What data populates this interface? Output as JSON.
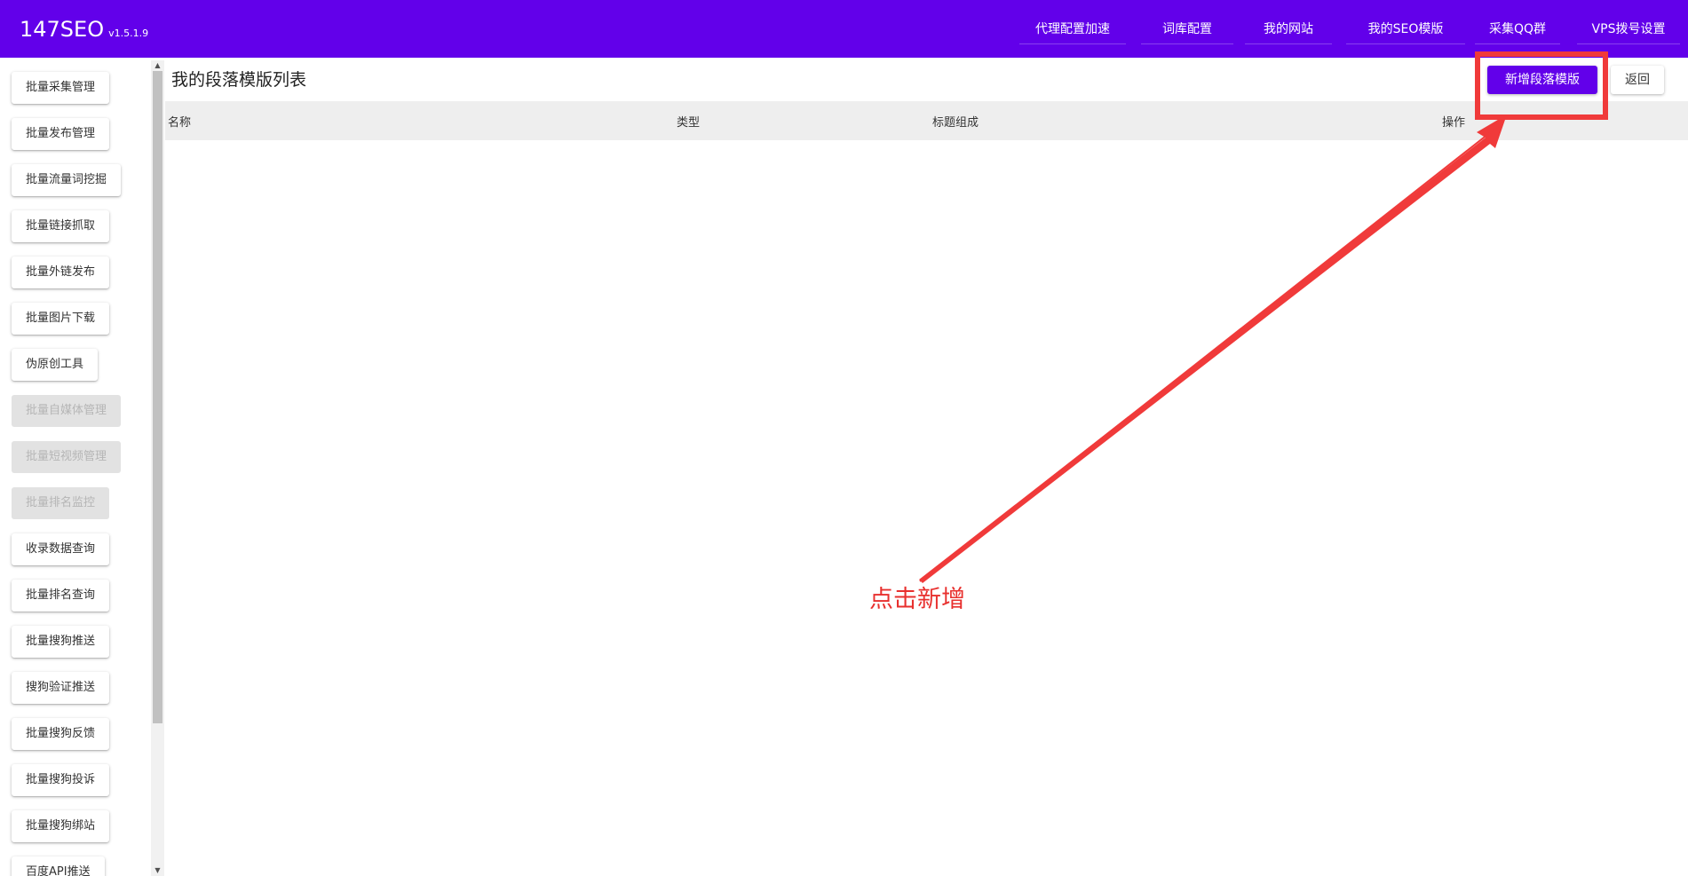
{
  "header": {
    "brand": "147SEO",
    "version": "v1.5.1.9",
    "nav": [
      {
        "label": "代理配置加速"
      },
      {
        "label": "词库配置"
      },
      {
        "label": "我的网站"
      },
      {
        "label": "我的SEO模版"
      },
      {
        "label": "采集QQ群"
      },
      {
        "label": "VPS拨号设置"
      }
    ]
  },
  "sidebar": {
    "items": [
      {
        "label": "批量采集管理",
        "enabled": true
      },
      {
        "label": "批量发布管理",
        "enabled": true
      },
      {
        "label": "批量流量词挖掘",
        "enabled": true
      },
      {
        "label": "批量链接抓取",
        "enabled": true
      },
      {
        "label": "批量外链发布",
        "enabled": true
      },
      {
        "label": "批量图片下载",
        "enabled": true
      },
      {
        "label": "伪原创工具",
        "enabled": true
      },
      {
        "label": "批量自媒体管理",
        "enabled": false
      },
      {
        "label": "批量短视频管理",
        "enabled": false
      },
      {
        "label": "批量排名监控",
        "enabled": false
      },
      {
        "label": "收录数据查询",
        "enabled": true
      },
      {
        "label": "批量排名查询",
        "enabled": true
      },
      {
        "label": "批量搜狗推送",
        "enabled": true
      },
      {
        "label": "搜狗验证推送",
        "enabled": true
      },
      {
        "label": "批量搜狗反馈",
        "enabled": true
      },
      {
        "label": "批量搜狗投诉",
        "enabled": true
      },
      {
        "label": "批量搜狗绑站",
        "enabled": true
      },
      {
        "label": "百度API推送",
        "enabled": true
      }
    ]
  },
  "main": {
    "title": "我的段落模版列表",
    "add_button": "新增段落模版",
    "back_button": "返回",
    "table": {
      "columns": [
        "名称",
        "类型",
        "标题组成",
        "操作"
      ],
      "rows": []
    }
  },
  "annotation": {
    "text": "点击新增",
    "color": "#f03a3a"
  },
  "colors": {
    "primary": "#6200ea",
    "header_bg": "#6200ea",
    "table_head_bg": "#eeeeee",
    "disabled_bg": "#e2e2e2"
  }
}
